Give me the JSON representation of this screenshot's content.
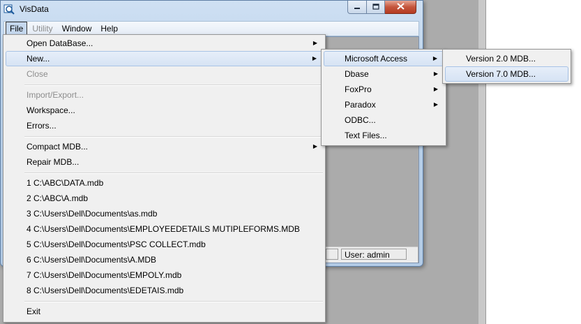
{
  "window": {
    "title": "VisData"
  },
  "menubar": [
    {
      "label": "File",
      "state": "active"
    },
    {
      "label": "Utility",
      "state": "disabled"
    },
    {
      "label": "Window",
      "state": "normal"
    },
    {
      "label": "Help",
      "state": "normal"
    }
  ],
  "status": {
    "user": "User: admin"
  },
  "file_menu": {
    "open": "Open DataBase...",
    "new": "New...",
    "close": "Close",
    "import_export": "Import/Export...",
    "workspace": "Workspace...",
    "errors": "Errors...",
    "compact": "Compact MDB...",
    "repair": "Repair MDB...",
    "recent": [
      "1 C:\\ABC\\DATA.mdb",
      "2 C:\\ABC\\A.mdb",
      "3 C:\\Users\\Dell\\Documents\\as.mdb",
      "4 C:\\Users\\Dell\\Documents\\EMPLOYEEDETAILS MUTIPLEFORMS.MDB",
      "5 C:\\Users\\Dell\\Documents\\PSC COLLECT.mdb",
      "6 C:\\Users\\Dell\\Documents\\A.MDB",
      "7 C:\\Users\\Dell\\Documents\\EMPOLY.mdb",
      "8 C:\\Users\\Dell\\Documents\\EDETAIS.mdb"
    ],
    "exit": "Exit"
  },
  "new_menu": {
    "access": "Microsoft Access",
    "dbase": "Dbase",
    "foxpro": "FoxPro",
    "paradox": "Paradox",
    "odbc": "ODBC...",
    "text": "Text Files..."
  },
  "access_menu": {
    "v2": "Version 2.0 MDB...",
    "v7": "Version 7.0 MDB..."
  }
}
